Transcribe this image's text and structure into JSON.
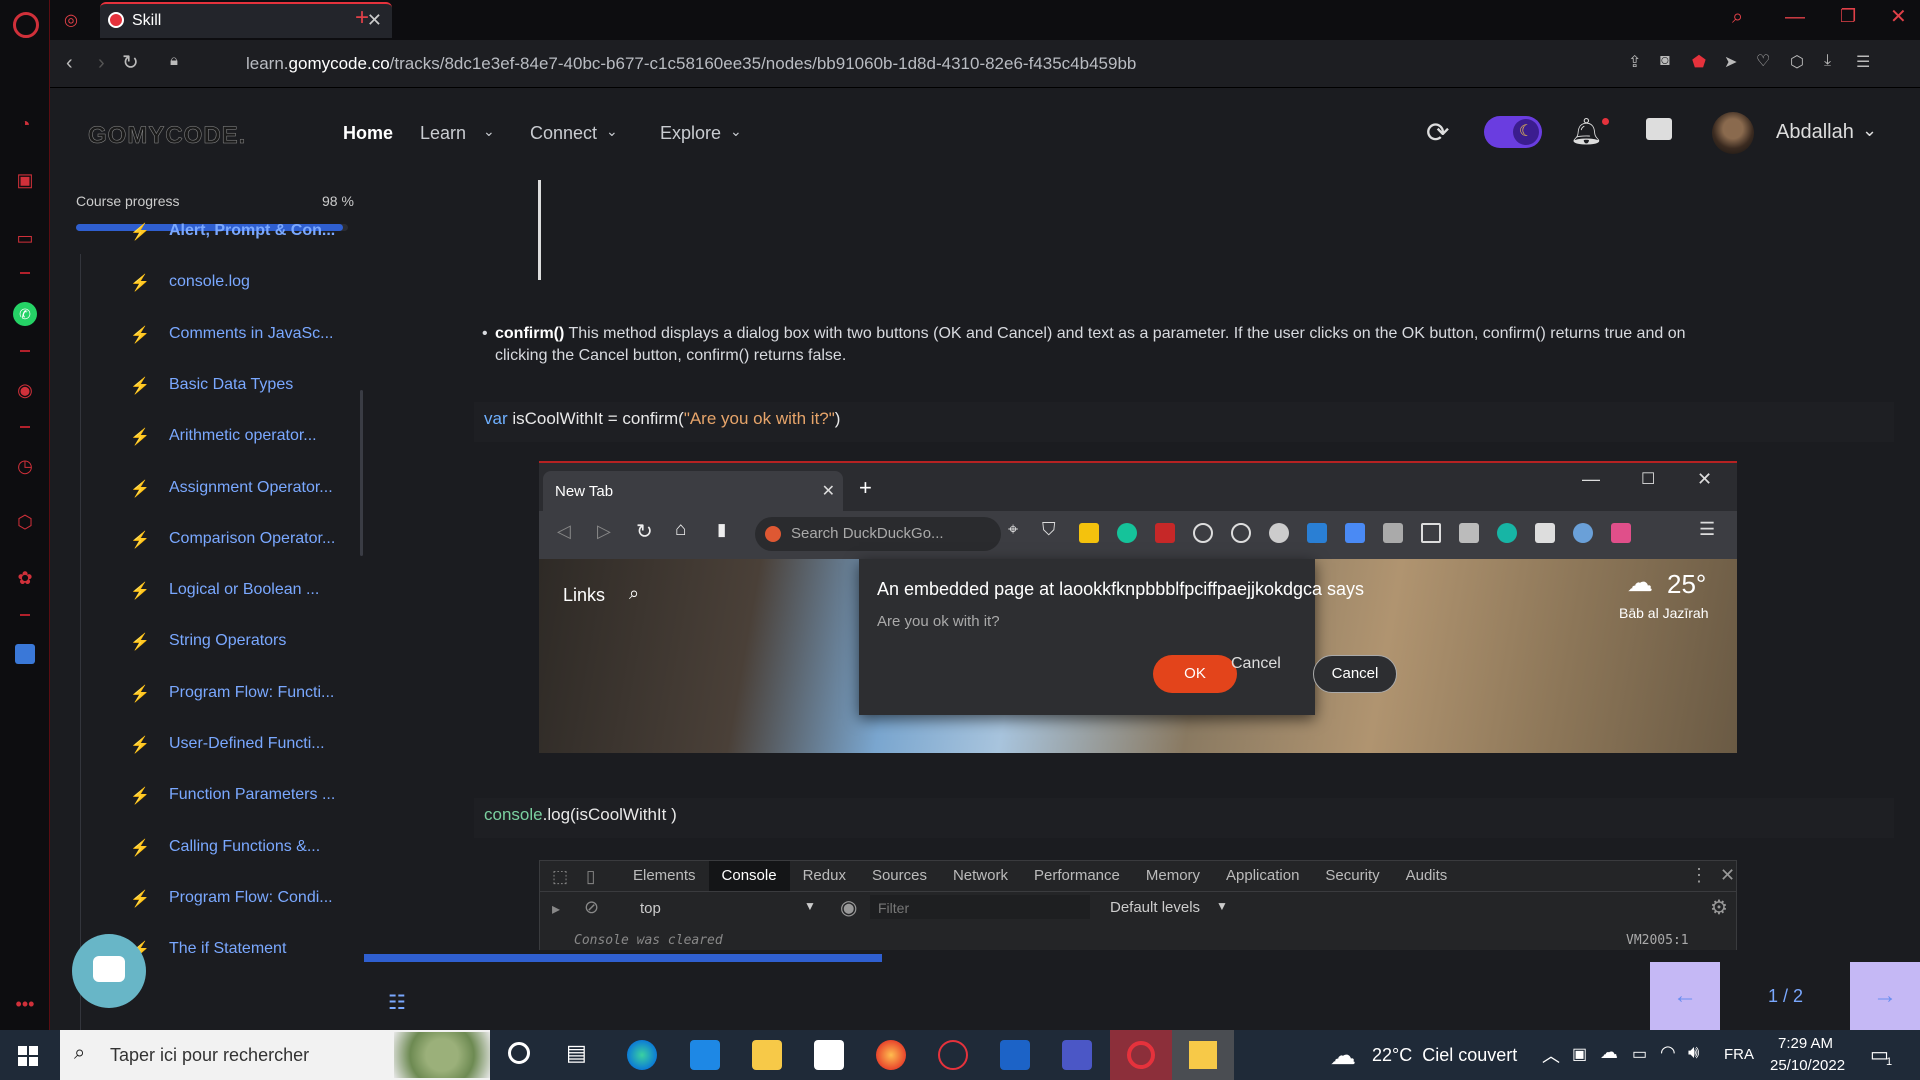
{
  "browser": {
    "tab_title": "Skill",
    "url_prefix": "learn.",
    "url_domain": "gomycode.co",
    "url_path": "/tracks/8dc1e3ef-84e7-40bc-b677-c1c58160ee35/nodes/bb91060b-1d8d-4310-82e6-f435c4b459bb"
  },
  "site": {
    "logo": "GOMYCODE.",
    "nav": {
      "home": "Home",
      "learn": "Learn",
      "connect": "Connect",
      "explore": "Explore"
    },
    "user_name": "Abdallah"
  },
  "progress": {
    "label": "Course progress",
    "percent_text": "98 %",
    "fraction": 0.98
  },
  "lessons": [
    "Alert, Prompt & Con...",
    "console.log",
    "Comments in JavaSc...",
    "Basic Data Types",
    "Arithmetic operator...",
    "Assignment Operator...",
    "Comparison Operator...",
    "Logical or Boolean ...",
    "String Operators",
    "Program Flow: Functi...",
    "User-Defined Functi...",
    "Function Parameters ...",
    "Calling Functions &...",
    "Program Flow: Condi...",
    "The if Statement"
  ],
  "content": {
    "bullet_bold": "confirm()",
    "bullet_text": " This method displays a dialog box with two buttons (OK and Cancel) and text as a parameter. If the user clicks on the OK button, confirm() returns true and on",
    "bullet_text2": "clicking the Cancel button, confirm() returns false.",
    "code1_kw": "var",
    "code1_mid": " isCoolWithIt = confirm(",
    "code1_str": "\"Are you ok with it?\"",
    "code1_end": ")",
    "code2_fn": "console",
    "code2_rest": ".log(isCoolWithIt )"
  },
  "embed": {
    "tab_title": "New Tab",
    "search_placeholder": "Search DuckDuckGo...",
    "links_label": "Links",
    "weather_temp": "25°",
    "weather_place": "Bāb al Jazīrah",
    "dialog_title": "An embedded page at laookkfknpbbblfpciffpaejjkokdgca says",
    "dialog_message": "Are you ok with it?",
    "ok": "OK",
    "cancel": "Cancel"
  },
  "devtools": {
    "tabs": [
      "Elements",
      "Console",
      "Redux",
      "Sources",
      "Network",
      "Performance",
      "Memory",
      "Application",
      "Security",
      "Audits"
    ],
    "context": "top",
    "filter_placeholder": "Filter",
    "levels": "Default levels",
    "cleared": "Console was cleared",
    "source": "VM2005:1"
  },
  "pager": {
    "text": "1 / 2"
  },
  "taskbar": {
    "search_placeholder": "Taper ici pour rechercher",
    "weather": "22°C  Ciel couvert",
    "lang": "FRA",
    "time": "7:29 AM",
    "date": "25/10/2022",
    "notif_count": "1"
  },
  "colors": {
    "accent": "#e5323c",
    "link": "#7aa8ff",
    "progress": "#2f5fd0",
    "pager": "#c5b8f5"
  }
}
